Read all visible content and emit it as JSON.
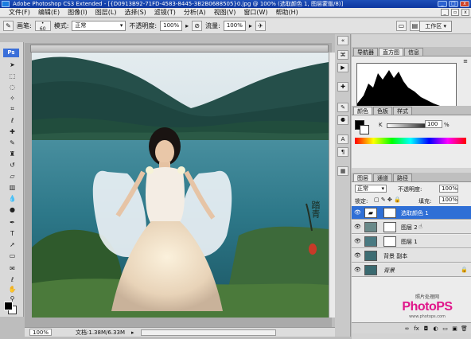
{
  "window": {
    "title": "Adobe Photoshop CS3 Extended - [{D0913B92-71FD-4583-8445-3B2B0688505}0.jpg @ 100% (选取颜色 1, 图层蒙版/8)]",
    "minimize": "_",
    "maximize": "□",
    "close": "x"
  },
  "menu": {
    "items": [
      "文件(F)",
      "编辑(E)",
      "图像(I)",
      "图层(L)",
      "选择(S)",
      "滤镜(T)",
      "分析(A)",
      "视图(V)",
      "窗口(W)",
      "帮助(H)"
    ]
  },
  "options": {
    "brush_label": "画笔:",
    "brush_size": "60",
    "mode_label": "模式:",
    "mode_value": "正常",
    "opacity_label": "不透明度:",
    "opacity_value": "100%",
    "flow_label": "流量:",
    "flow_value": "100%",
    "workspace_label": "工作区 ▾"
  },
  "tools": {
    "logo": "Ps"
  },
  "status": {
    "zoom": "100%",
    "doc_info": "文档:1.38M/6.33M"
  },
  "panels": {
    "navigator_tabs": [
      "导航器",
      "直方图",
      "信息"
    ],
    "color_tabs": [
      "颜色",
      "色板",
      "样式"
    ],
    "color_channel": "K",
    "color_value": "100",
    "color_percent": "%",
    "layers_tabs": [
      "图层",
      "通道",
      "路径"
    ],
    "blend_mode": "正常",
    "opacity_label": "不透明度:",
    "opacity_value": "100%",
    "lock_label": "锁定:",
    "fill_label": "填充:",
    "fill_value": "100%",
    "layers": [
      {
        "name": "选取颜色 1",
        "selected": true
      },
      {
        "name": "图层 2",
        "selected": false
      },
      {
        "name": "图层 1",
        "selected": false
      },
      {
        "name": "背景 副本",
        "selected": false
      },
      {
        "name": "背景",
        "selected": false
      }
    ]
  },
  "watermark": {
    "line1": "照片处理网",
    "brand": "PhotoPS",
    "site": "www.photops.com"
  },
  "signature": {
    "text": "踏青"
  },
  "colors": {
    "titlebar": "#0d36a0",
    "selected_layer": "#2f6fd6",
    "brand_pink": "#e0168a",
    "brand_blue": "#2050d0"
  }
}
